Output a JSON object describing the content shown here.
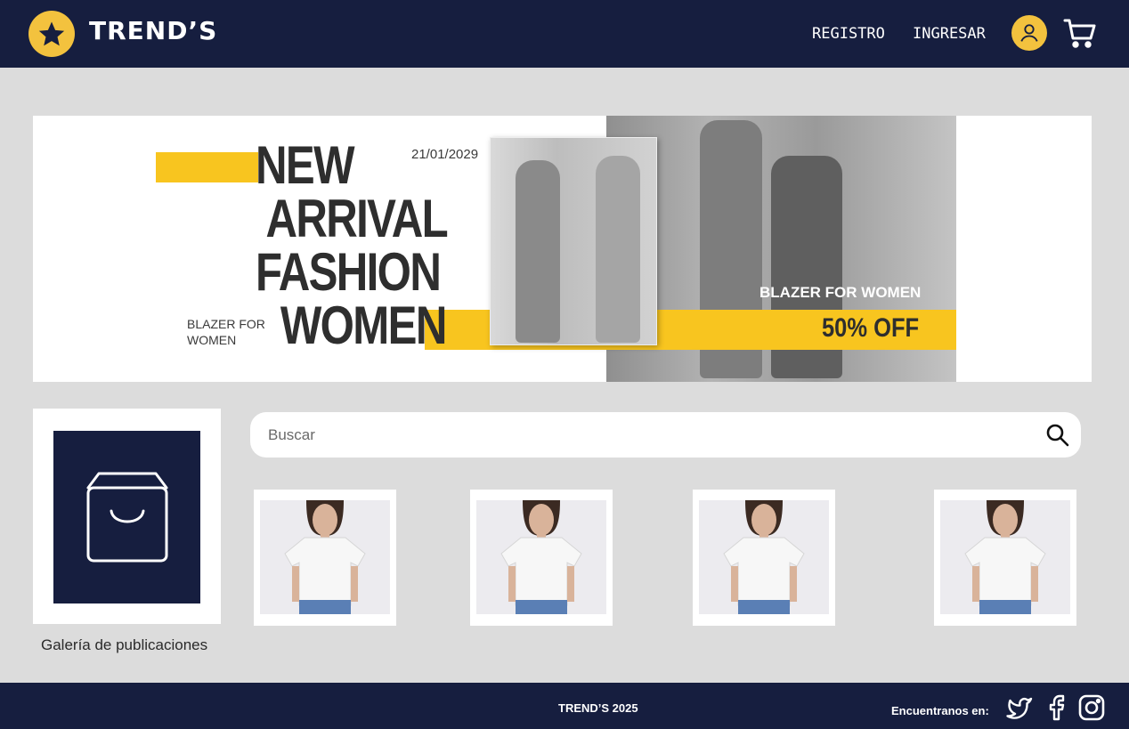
{
  "header": {
    "brand": "TREND’S",
    "nav": {
      "registro": "REGISTRO",
      "ingresar": "INGRESAR"
    },
    "icons": {
      "logo": "star-icon",
      "user": "user-icon",
      "cart": "cart-icon"
    },
    "colors": {
      "background": "#161e3f",
      "accent": "#f3c23e"
    }
  },
  "banner": {
    "headline": [
      "NEW",
      "ARRIVAL",
      "FASHION",
      "WOMEN"
    ],
    "date": "21/01/2029",
    "blazer_left": "BLAZER FOR WOMEN",
    "blazer_right": "BLAZER FOR WOMEN",
    "discount": "50% OFF",
    "accent_color": "#f8c51f"
  },
  "gallery": {
    "label": "Galería de publicaciones",
    "icon": "shopping-bag-icon"
  },
  "search": {
    "placeholder": "Buscar",
    "value": "",
    "icon": "search-icon"
  },
  "products": [
    {
      "name": "white-tshirt"
    },
    {
      "name": "white-tshirt"
    },
    {
      "name": "white-tshirt"
    },
    {
      "name": "white-tshirt"
    }
  ],
  "footer": {
    "copyright": "TREND’S 2025",
    "find_us": "Encuentranos en:",
    "social_icons": [
      "twitter-icon",
      "facebook-icon",
      "instagram-icon"
    ]
  }
}
